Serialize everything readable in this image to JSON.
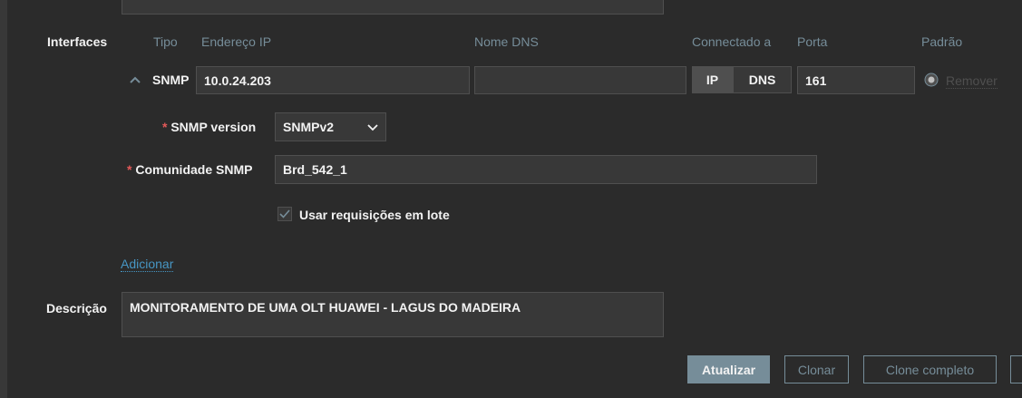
{
  "interfaces": {
    "label": "Interfaces",
    "headers": {
      "tipo": "Tipo",
      "endereco_ip": "Endereço IP",
      "nome_dns": "Nome DNS",
      "conectado_a": "Connectado a",
      "porta": "Porta",
      "padrao": "Padrão"
    },
    "row": {
      "type": "SNMP",
      "ip": "10.0.24.203",
      "dns": "",
      "connect_ip": "IP",
      "connect_dns": "DNS",
      "port": "161",
      "remove": "Remover"
    },
    "snmp_version": {
      "required": "*",
      "label": "SNMP version",
      "value": "SNMPv2"
    },
    "community": {
      "required": "*",
      "label": "Comunidade SNMP",
      "value": "Brd_542_1"
    },
    "bulk": {
      "label": "Usar requisições em lote",
      "checked": true
    },
    "add_link": "Adicionar"
  },
  "description": {
    "label": "Descrição",
    "value": "MONITORAMENTO DE UMA OLT HUAWEI - LAGUS DO MADEIRA"
  },
  "actions": {
    "update": "Atualizar",
    "clone": "Clonar",
    "full_clone": "Clone completo"
  },
  "colors": {
    "background": "#2b2b2b",
    "input_bg": "#383838",
    "border": "#4f4f4f",
    "muted": "#768d99",
    "link": "#4796c4",
    "required": "#e45959"
  }
}
